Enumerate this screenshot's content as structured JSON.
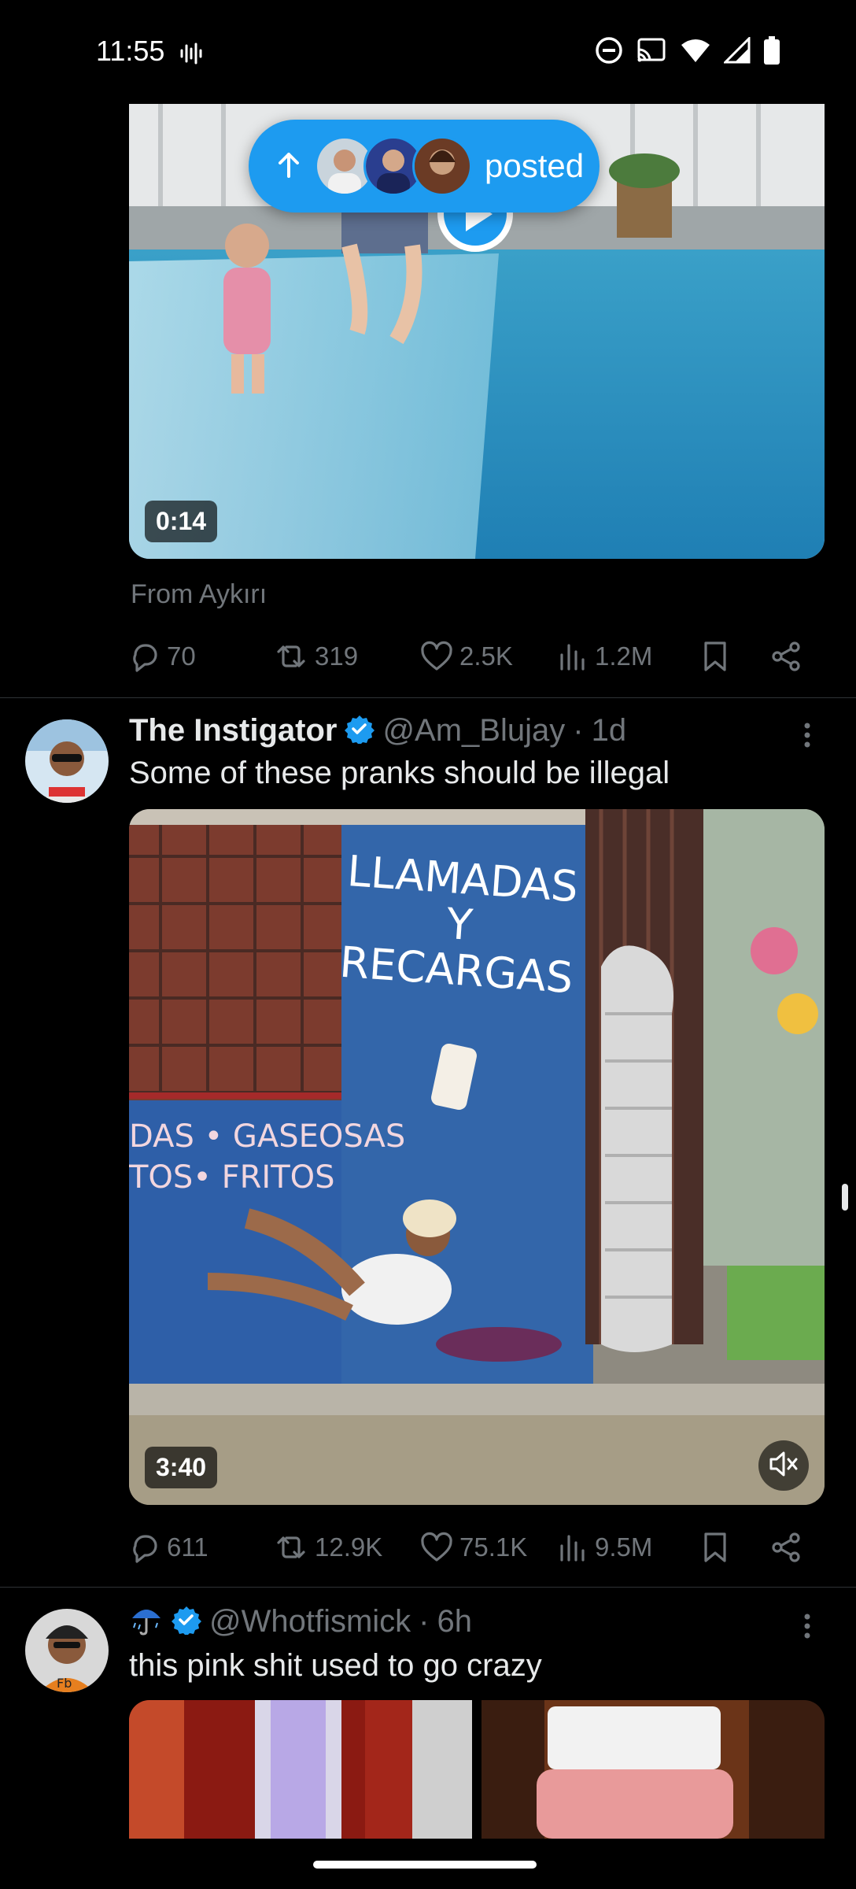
{
  "status_bar": {
    "time": "11:55"
  },
  "posted_pill": {
    "label": "posted"
  },
  "tweet1": {
    "video_duration": "0:14",
    "from_text": "From Aykırı",
    "replies": "70",
    "reposts": "319",
    "likes": "2.5K",
    "views": "1.2M"
  },
  "tweet2": {
    "name": "The Instigator",
    "handle": "@Am_Blujay",
    "time": "1d",
    "text": "Some of these pranks should be illegal",
    "video_duration": "3:40",
    "replies": "611",
    "reposts": "12.9K",
    "likes": "75.1K",
    "views": "9.5M",
    "video_sign_line1": "LLAMADAS",
    "video_sign_line2": "Y",
    "video_sign_line3": "RECARGAS",
    "video_sign_line4": "DAS • GASEOSAS",
    "video_sign_line5": "TOS• FRITOS"
  },
  "tweet3": {
    "handle": "@Whotfismick",
    "time": "6h",
    "text": "this pink shit used to go crazy"
  },
  "colors": {
    "accent": "#1d9bf0",
    "muted": "#71767b",
    "background": "#000000",
    "text": "#e7e9ea"
  }
}
